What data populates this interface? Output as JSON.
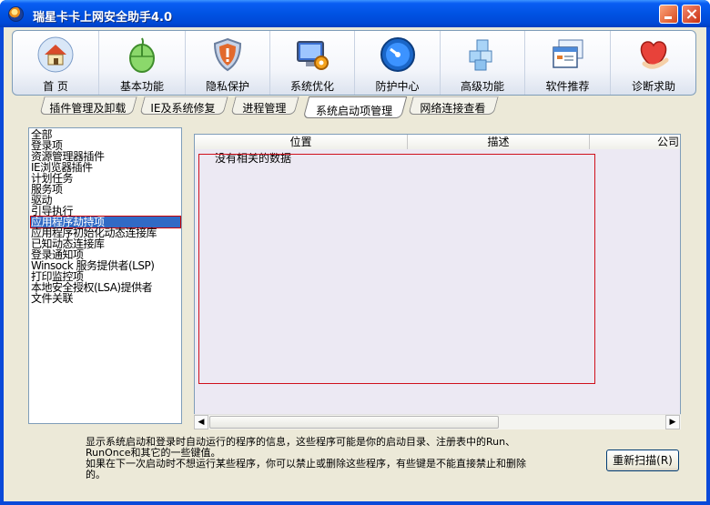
{
  "window": {
    "title": "瑞星卡卡上网安全助手4.0"
  },
  "toolbar": {
    "items": [
      {
        "label": "首 页",
        "icon": "home-icon"
      },
      {
        "label": "基本功能",
        "icon": "mouse-icon"
      },
      {
        "label": "隐私保护",
        "icon": "shield-icon"
      },
      {
        "label": "系统优化",
        "icon": "monitor-gear-icon"
      },
      {
        "label": "防护中心",
        "icon": "protection-dial-icon"
      },
      {
        "label": "高级功能",
        "icon": "cubes-icon"
      },
      {
        "label": "软件推荐",
        "icon": "window-stack-icon"
      },
      {
        "label": "诊断求助",
        "icon": "heart-hand-icon"
      }
    ]
  },
  "tabs": [
    {
      "label": "插件管理及卸载"
    },
    {
      "label": "IE及系统修复"
    },
    {
      "label": "进程管理"
    },
    {
      "label": "系统启动项管理",
      "active": true
    },
    {
      "label": "网络连接查看"
    }
  ],
  "categories": [
    "全部",
    "登录项",
    "资源管理器插件",
    "IE浏览器插件",
    "计划任务",
    "服务项",
    "驱动",
    "引导执行",
    "应用程序劫持项",
    "应用程序初始化动态连接库",
    "已知动态连接库",
    "登录通知项",
    "Winsock 服务提供者(LSP)",
    "打印监控项",
    "本地安全授权(LSA)提供者",
    "文件关联"
  ],
  "selected_category": "应用程序劫持项",
  "grid": {
    "columns": [
      "位置",
      "描述",
      "公司"
    ],
    "empty_text": "没有相关的数据"
  },
  "description": {
    "line1": "显示系统启动和登录时自动运行的程序的信息，这些程序可能是你的启动目录、注册表中的Run、",
    "line2": "RunOnce和其它的一些键值。",
    "line3": "如果在下一次启动时不想运行某些程序，你可以禁止或删除这些程序，有些键是不能直接禁止和删除",
    "line4": "的。"
  },
  "buttons": {
    "rescan": "重新扫描(R)"
  }
}
